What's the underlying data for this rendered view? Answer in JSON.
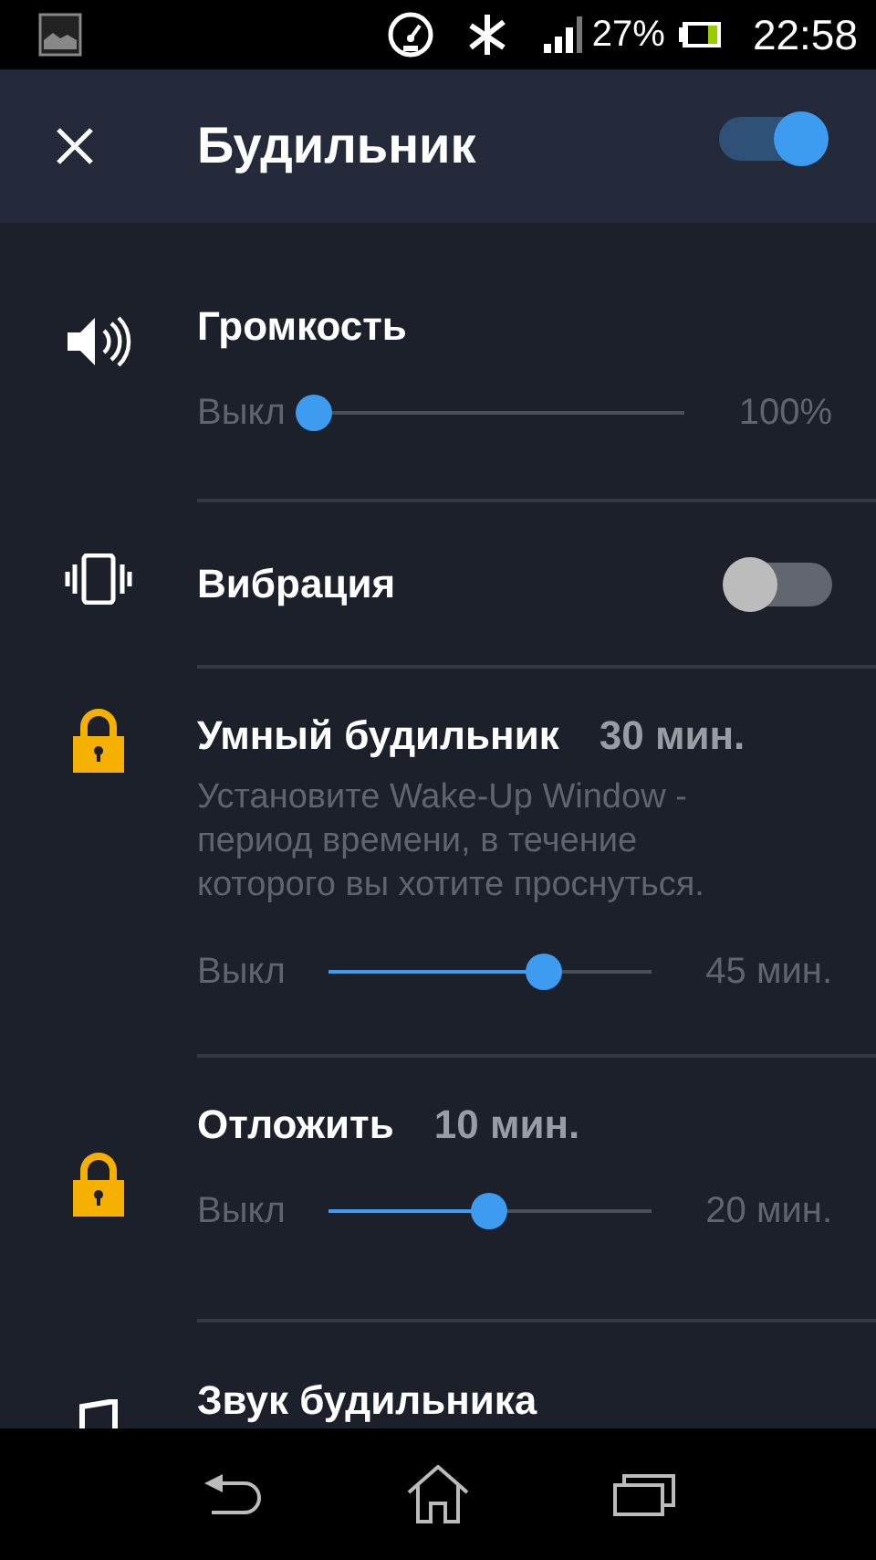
{
  "status_bar": {
    "battery_text": "27%",
    "time": "22:58"
  },
  "app_bar": {
    "title": "Будильник",
    "enabled": true
  },
  "settings": [
    {
      "kind": "slider",
      "title": "Громкость",
      "locked": false,
      "min_label": "Выкл",
      "max_label": "100%",
      "level": 0
    },
    {
      "kind": "toggle",
      "title": "Вибрация",
      "locked": false,
      "on": false
    },
    {
      "kind": "slider",
      "title": "Умный будильник",
      "value": "30 мин.",
      "description": "Установите Wake-Up Window - период времени, в течение которого вы хотите проснуться.",
      "locked": true,
      "min_label": "Выкл",
      "max_label": "45 мин.",
      "level": 0.69
    },
    {
      "kind": "slider",
      "title": "Отложить",
      "value": "10 мин.",
      "locked": true,
      "min_label": "Выкл",
      "max_label": "20 мин.",
      "level": 0.5
    },
    {
      "kind": "link",
      "title": "Звук будильника",
      "locked": false
    }
  ]
}
